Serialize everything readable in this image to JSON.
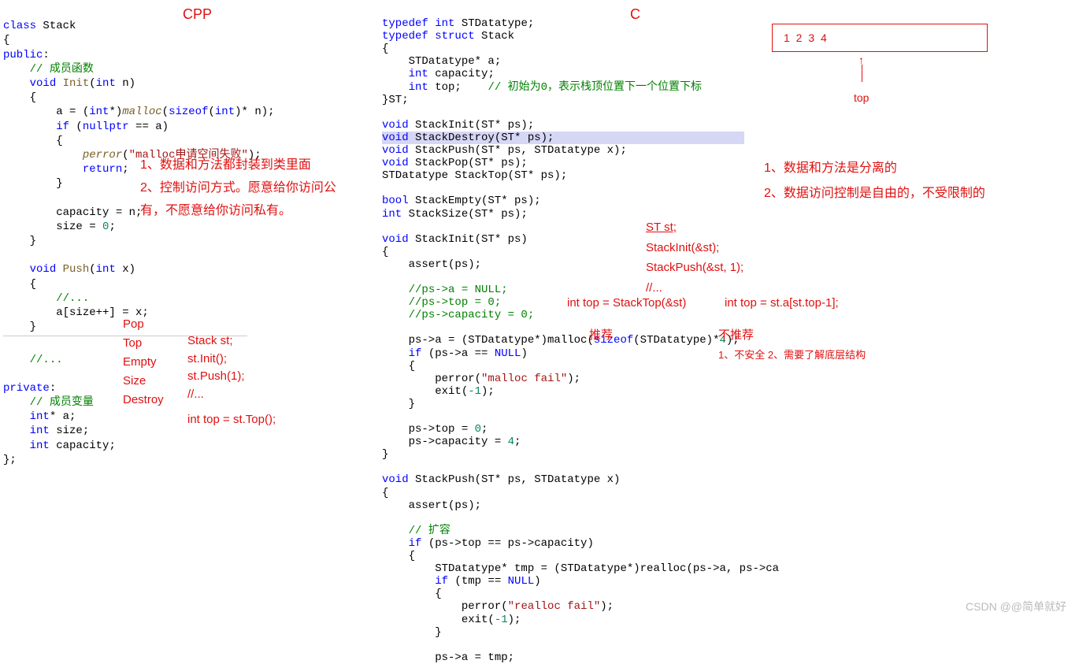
{
  "labels": {
    "cpp": "CPP",
    "c": "C"
  },
  "cpp_code": {
    "line1": "class Stack",
    "line2": "{",
    "line3": "public:",
    "c_member_func": "// 成员函数",
    "init_sig": "void Init(int n)",
    "malloc_line": "a = (int*)malloc(sizeof(int)* n);",
    "if_null": "if (nullptr == a)",
    "perror": "perror(\"malloc申请空间失败\");",
    "ret": "return;",
    "cap": "capacity = n;",
    "size": "size = 0;",
    "push_sig": "void Push(int x)",
    "push_body": "a[size++] = x;",
    "dots": "//...",
    "private": "private:",
    "c_member_var": "// 成员变量",
    "pa": "int* a;",
    "psize": "int size;",
    "pcap": "int capacity;"
  },
  "cpp_anno": {
    "a1": "1、数据和方法都封装到类里面",
    "a2": "2、控制访问方式。愿意给你访问公有，不愿意给你访问私有。"
  },
  "methods": [
    "Pop",
    "Top",
    "Empty",
    "Size",
    "Destroy"
  ],
  "usage": {
    "decl": "Stack st;",
    "init": "st.Init();",
    "push": "st.Push(1);",
    "dots": "//...",
    "top": "int top = st.Top();"
  },
  "c_code": {
    "typedef1": "typedef int STDatatype;",
    "typedef2": "typedef struct Stack",
    "field_a": "STDatatype* a;",
    "field_cap": "int capacity;",
    "field_top": "int top;",
    "top_comment": "// 初始为0，表示栈顶位置下一个位置下标",
    "end_st": "}ST;",
    "decl_init": "void StackInit(ST* ps);",
    "decl_destroy": "void StackDestroy(ST* ps);",
    "decl_push": "void StackPush(ST* ps, STDatatype x);",
    "decl_pop": "void StackPop(ST* ps);",
    "decl_top": "STDatatype StackTop(ST* ps);",
    "decl_empty": "bool StackEmpty(ST* ps);",
    "decl_size": "int StackSize(ST* ps);",
    "impl_init": "void StackInit(ST* ps)",
    "assert": "assert(ps);",
    "c1": "//ps->a = NULL;",
    "c2": "//ps->top = 0;",
    "c3": "//ps->capacity = 0;",
    "malloc": "ps->a = (STDatatype*)malloc(sizeof(STDatatype)*4);",
    "ifnull": "if (ps->a == NULL)",
    "perror": "perror(\"malloc fail\");",
    "exit": "exit(-1);",
    "settop": "ps->top = 0;",
    "setcap": "ps->capacity = 4;",
    "impl_push": "void StackPush(ST* ps, STDatatype x)",
    "expand_comment": "// 扩容",
    "ifcap": "if (ps->top == ps->capacity)",
    "tmp": "STDatatype* tmp = (STDatatype*)realloc(ps->a, ps->ca",
    "iftmp": "if (tmp == NULL)",
    "perror2": "perror(\"realloc fail\");",
    "assign_tmp": "ps->a = tmp;"
  },
  "c_anno": {
    "a1": "1、数据和方法是分离的",
    "a2": "2、数据访问控制是自由的，不受限制的"
  },
  "mid_usage": {
    "decl": "ST st;",
    "init": "StackInit(&st);",
    "push": "StackPush(&st, 1);",
    "dots": "//..."
  },
  "compare": {
    "good": "int top = StackTop(&st)",
    "bad": "int top = st.a[st.top-1];",
    "rec": "推荐",
    "norec": "不推荐",
    "reason": "1、不安全   2、需要了解底层结构"
  },
  "table": {
    "items": "1    2    3    4",
    "top": "top"
  },
  "watermark": "CSDN @@简单就好"
}
